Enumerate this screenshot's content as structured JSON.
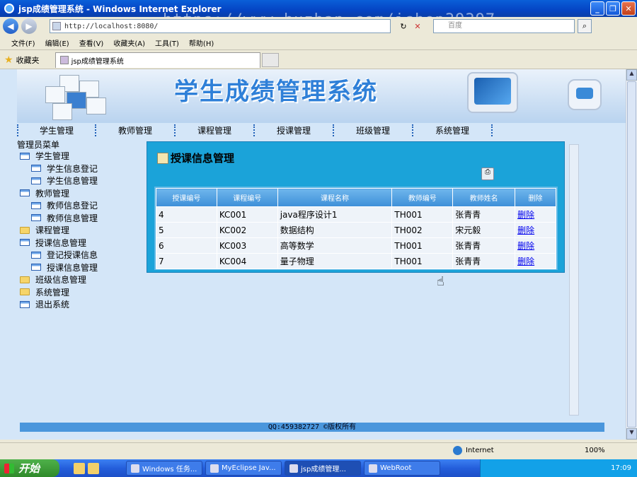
{
  "window": {
    "title": "jsp成绩管理系统 - Windows Internet Explorer"
  },
  "watermark": "https://www.huzhan.com/ishop39397",
  "browser": {
    "address": "http://localhost:8080/",
    "search_placeholder": "百度",
    "menu": [
      "文件(F)",
      "编辑(E)",
      "查看(V)",
      "收藏夹(A)",
      "工具(T)",
      "帮助(H)"
    ],
    "favorites_label": "收藏夹",
    "tab_title": "jsp成绩管理系统"
  },
  "banner": {
    "title": "学生成绩管理系统"
  },
  "topnav": [
    "学生管理",
    "教师管理",
    "课程管理",
    "授课管理",
    "班级管理",
    "系统管理"
  ],
  "sidebar": {
    "heading": "管理员菜单",
    "items": [
      {
        "label": "学生管理",
        "level": 1,
        "icon": "window-icon"
      },
      {
        "label": "学生信息登记",
        "level": 2,
        "icon": "window-icon"
      },
      {
        "label": "学生信息管理",
        "level": 2,
        "icon": "window-icon"
      },
      {
        "label": "教师管理",
        "level": 1,
        "icon": "window-icon"
      },
      {
        "label": "教师信息登记",
        "level": 2,
        "icon": "window-icon"
      },
      {
        "label": "教师信息管理",
        "level": 2,
        "icon": "window-icon"
      },
      {
        "label": "课程管理",
        "level": 1,
        "icon": "folder-icon"
      },
      {
        "label": "授课信息管理",
        "level": 1,
        "icon": "window-icon"
      },
      {
        "label": "登记授课信息",
        "level": 2,
        "icon": "window-icon"
      },
      {
        "label": "授课信息管理",
        "level": 2,
        "icon": "window-icon"
      },
      {
        "label": "班级信息管理",
        "level": 1,
        "icon": "folder-icon"
      },
      {
        "label": "系统管理",
        "level": 1,
        "icon": "folder-icon"
      },
      {
        "label": "退出系统",
        "level": 1,
        "icon": "window-icon"
      }
    ]
  },
  "panel": {
    "title": "授课信息管理",
    "columns": [
      "授课编号",
      "课程编号",
      "课程名称",
      "教师编号",
      "教师姓名",
      "删除"
    ],
    "rows": [
      [
        "4",
        "KC001",
        "java程序设计1",
        "TH001",
        "张青青",
        "删除"
      ],
      [
        "5",
        "KC002",
        "数据结构",
        "TH002",
        "宋元毅",
        "删除"
      ],
      [
        "6",
        "KC003",
        "高等数学",
        "TH001",
        "张青青",
        "删除"
      ],
      [
        "7",
        "KC004",
        "量子物理",
        "TH001",
        "张青青",
        "删除"
      ]
    ]
  },
  "footer": "QQ:459382727 ©版权所有",
  "status": {
    "zone": "Internet",
    "zoom": "100%"
  },
  "taskbar": {
    "start": "开始",
    "buttons": [
      "Windows 任务...",
      "MyEclipse Jav...",
      "jsp成绩管理...",
      "WebRoot"
    ],
    "active_index": 2,
    "clock": "17:09"
  }
}
